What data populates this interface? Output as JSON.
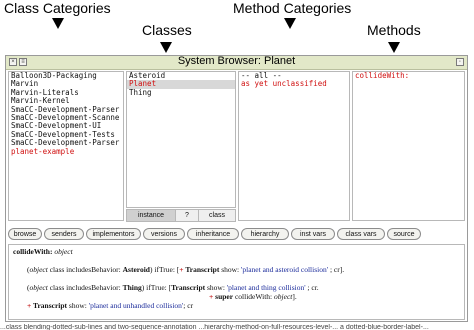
{
  "annotations": {
    "class_categories": "Class Categories",
    "classes": "Classes",
    "method_categories": "Method Categories",
    "methods": "Methods"
  },
  "window": {
    "title": "System Browser: Planet",
    "close_glyph": "×",
    "menu_glyph": "≡",
    "collapse_glyph": "◦"
  },
  "panes": {
    "class_categories": [
      "Balloon3D-Packaging",
      "Marvin",
      "Marvin-Literals",
      "Marvin-Kernel",
      "SmaCC-Development-Parser",
      "SmaCC-Development-Scanne",
      "SmaCC-Development-UI",
      "SmaCC-Development-Tests",
      "SmaCC-Development-Parser",
      "planet-example"
    ],
    "classes": [
      "Asteroid",
      "Planet",
      "Thing"
    ],
    "method_categories": [
      "-- all --",
      "as yet unclassified"
    ],
    "methods": [
      "collideWith:"
    ]
  },
  "class_switch": {
    "instance": "instance",
    "help": "?",
    "class": "class"
  },
  "buttons": [
    "browse",
    "senders",
    "implementors",
    "versions",
    "inheritance",
    "hierarchy",
    "inst vars",
    "class vars",
    "source"
  ],
  "code": {
    "signature_selector": "collideWith:",
    "signature_arg": "object",
    "l1": {
      "p1": "(",
      "obj": "object",
      "p2": " class includesBehavior: ",
      "cls": "Asteroid",
      "p3": ") ifTrue: [",
      "plus": "+",
      "transcript": " Transcript",
      "show": " show: ",
      "str": "'planet and asteroid collision'",
      "p4": " ; cr]."
    },
    "l2": {
      "p1": "(",
      "obj": "object",
      "p2": " class includesBehavior: ",
      "cls": "Thing",
      "p3": ") ifTrue: [",
      "transcript": "Transcript",
      "show": " show: ",
      "str": "'planet and thing collision'",
      "p4": " ; cr."
    },
    "l3": {
      "plus": "+",
      "sup": " super",
      "call": " collideWith: ",
      "obj": "object",
      "p4": "]."
    },
    "l4": {
      "plus": "+",
      "transcript": " Transcript",
      "show": " show: ",
      "str": "'planet and unhandled collision'",
      "p4": "; cr"
    }
  },
  "bottom_fragment": "...class blending-dotted-sub-lines and two-sequence-annotation ...hierarchy-method-on-full-resources-level-... a dotted-blue-border-label-..."
}
